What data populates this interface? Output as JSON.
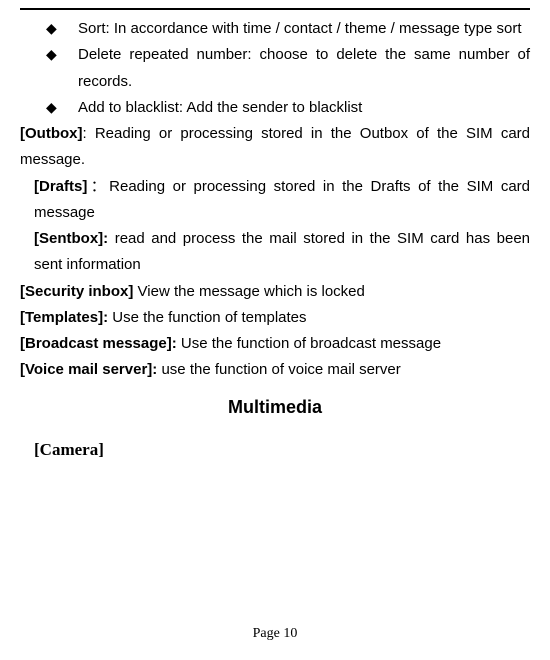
{
  "bullets": [
    "Sort: In accordance with time / contact / theme / message type sort",
    "Delete repeated number: choose to delete the same number of records.",
    "Add to blacklist: Add the sender to blacklist"
  ],
  "sections": {
    "outbox": {
      "label": "[Outbox]",
      "sep": ": ",
      "text": " Reading or processing stored in the Outbox of the SIM card message."
    },
    "drafts": {
      "label": "[Drafts]",
      "sep": "：",
      "text": "Reading or processing stored in the Drafts of the SIM card message"
    },
    "sentbox": {
      "label": "[Sentbox]:",
      "sep": " ",
      "text": "read and process the mail stored in the SIM card has been sent information"
    },
    "security": {
      "label": "[Security inbox]",
      "sep": " ",
      "text": "View the message which is locked"
    },
    "templates": {
      "label": "[Templates]:",
      "sep": " ",
      "text": "Use the function of templates"
    },
    "broadcast": {
      "label": "[Broadcast message]:",
      "sep": " ",
      "text": "Use the function of broadcast message"
    },
    "voicemail": {
      "label": "[Voice mail server]:",
      "sep": " ",
      "text": "use the function of voice mail server"
    }
  },
  "multimedia_title": "Multimedia",
  "camera_title": "[Camera]",
  "page_number": "Page 10"
}
